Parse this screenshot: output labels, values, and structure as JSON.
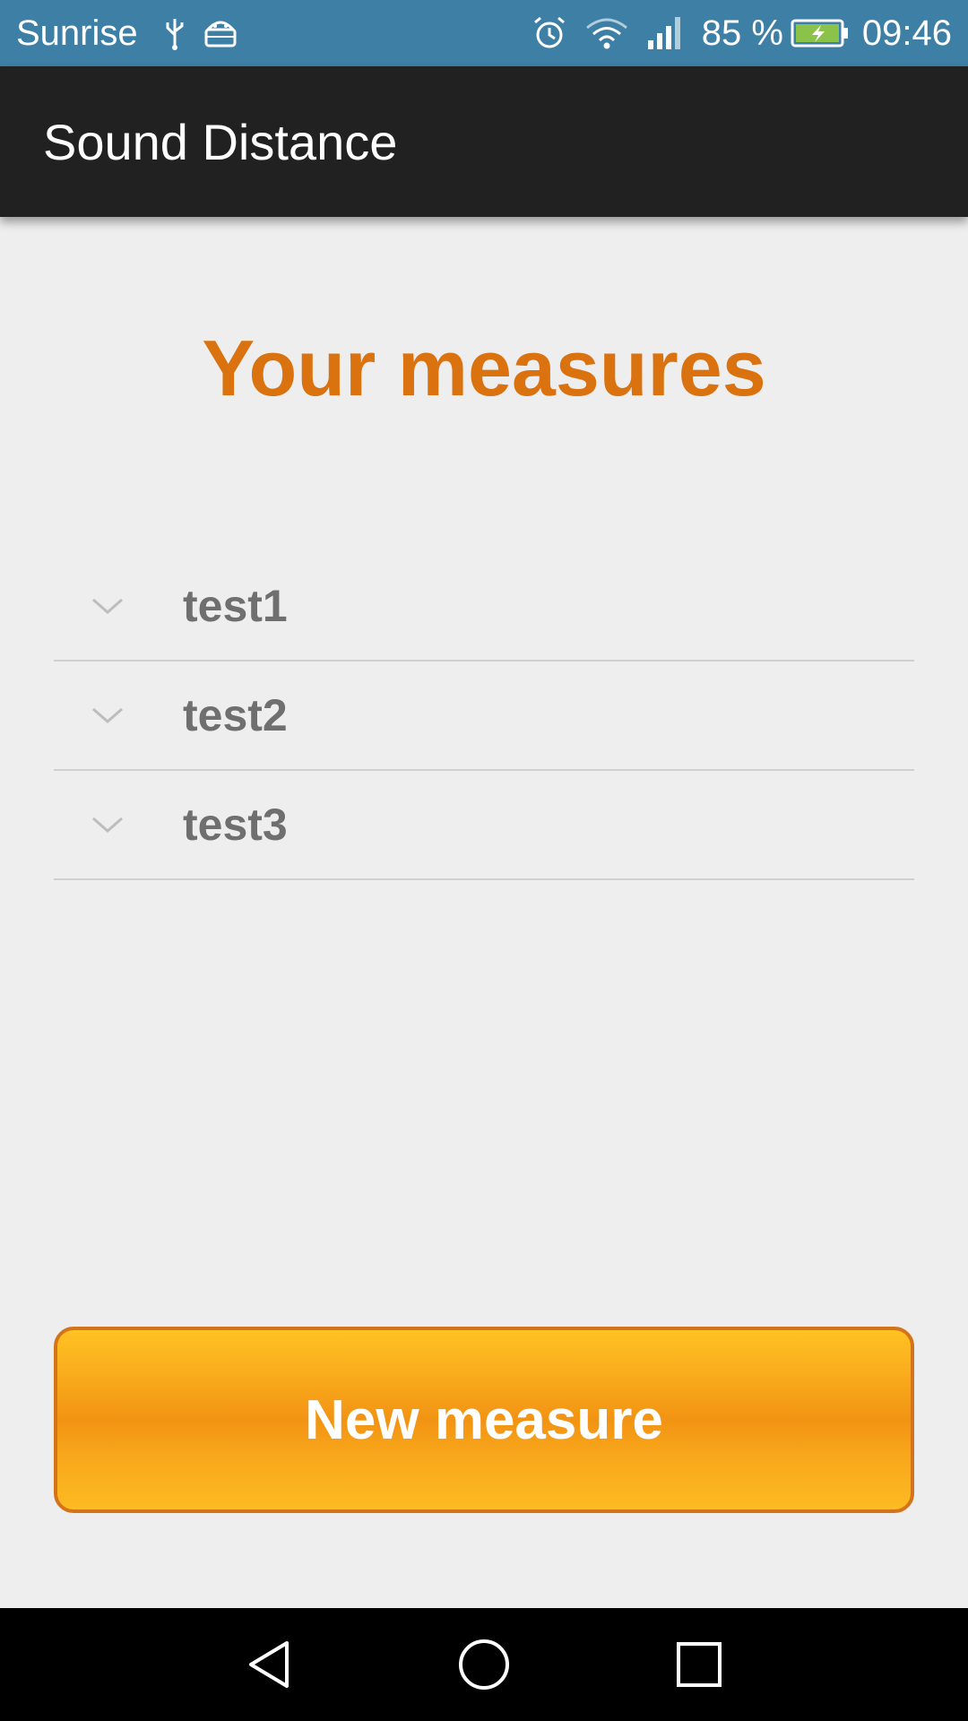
{
  "status_bar": {
    "carrier": "Sunrise",
    "battery_percent": "85 %",
    "time": "09:46",
    "icons": [
      "usb-icon",
      "android-debug-icon",
      "alarm-icon",
      "wifi-icon",
      "signal-icon",
      "battery-charging-icon"
    ]
  },
  "app_bar": {
    "title": "Sound Distance"
  },
  "main": {
    "heading": "Your measures",
    "measures": [
      {
        "label": "test1",
        "icon": "chevron-down-icon"
      },
      {
        "label": "test2",
        "icon": "chevron-down-icon"
      },
      {
        "label": "test3",
        "icon": "chevron-down-icon"
      }
    ],
    "new_measure_label": "New measure"
  },
  "nav_bar": {
    "icons": [
      "back-icon",
      "home-icon",
      "recents-icon"
    ]
  },
  "colors": {
    "status_bar": "#3e7fa6",
    "app_bar": "#212121",
    "accent": "#d9720f",
    "button_border": "#d4741a",
    "button_fill": "#f29313",
    "background": "#eeeeee"
  }
}
